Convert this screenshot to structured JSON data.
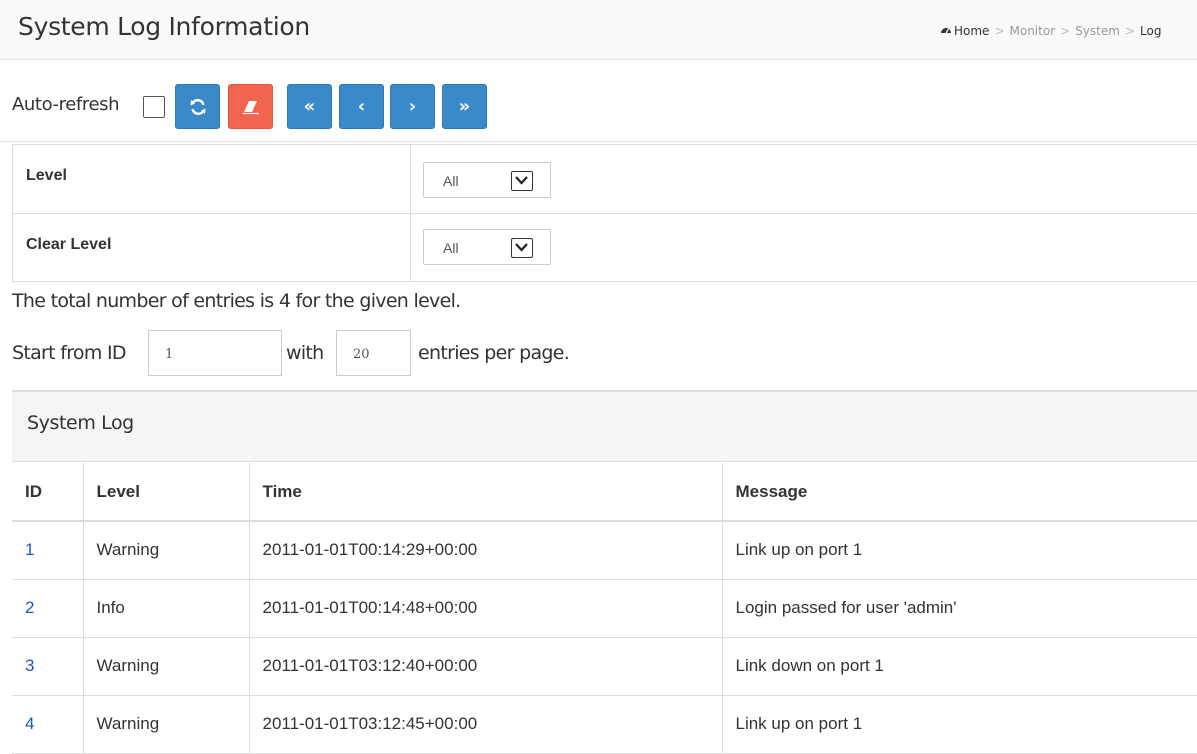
{
  "header": {
    "title": "System Log Information",
    "breadcrumb": {
      "home": "Home",
      "items": [
        "Monitor",
        "System",
        "Log"
      ]
    }
  },
  "toolbar": {
    "auto_refresh_label": "Auto-refresh",
    "auto_refresh_checked": false,
    "buttons": [
      {
        "name": "refresh",
        "glyph": "⟳",
        "color": "#3a8ac9"
      },
      {
        "name": "clear",
        "glyph": "eraser",
        "color": "#f0654f"
      },
      {
        "name": "first-page",
        "glyph": "«",
        "color": "#3a8ac9"
      },
      {
        "name": "prev-page",
        "glyph": "‹",
        "color": "#3a8ac9"
      },
      {
        "name": "next-page",
        "glyph": "›",
        "color": "#3a8ac9"
      },
      {
        "name": "last-page",
        "glyph": "»",
        "color": "#3a8ac9"
      }
    ]
  },
  "settings": {
    "level_label": "Level",
    "level_value": "All",
    "clear_level_label": "Clear Level",
    "clear_level_value": "All"
  },
  "summary": {
    "text": "The total number of entries is 4 for the given level."
  },
  "paging": {
    "start_label": "Start from ID",
    "start_value": "1",
    "with_label": "with",
    "entries_value": "20",
    "per_page_label": "entries per page."
  },
  "log": {
    "title": "System Log",
    "columns": [
      "ID",
      "Level",
      "Time",
      "Message"
    ],
    "rows": [
      {
        "id": "1",
        "level": "Warning",
        "time": "2011-01-01T00:14:29+00:00",
        "message": "Link up on port 1"
      },
      {
        "id": "2",
        "level": "Info",
        "time": "2011-01-01T00:14:48+00:00",
        "message": "Login passed for user 'admin'"
      },
      {
        "id": "3",
        "level": "Warning",
        "time": "2011-01-01T03:12:40+00:00",
        "message": "Link down on port 1"
      },
      {
        "id": "4",
        "level": "Warning",
        "time": "2011-01-01T03:12:45+00:00",
        "message": "Link up on port 1"
      }
    ]
  },
  "colors": {
    "primary_button": "#3a8ac9",
    "danger_button": "#f0654f",
    "link": "#1a57c9"
  }
}
